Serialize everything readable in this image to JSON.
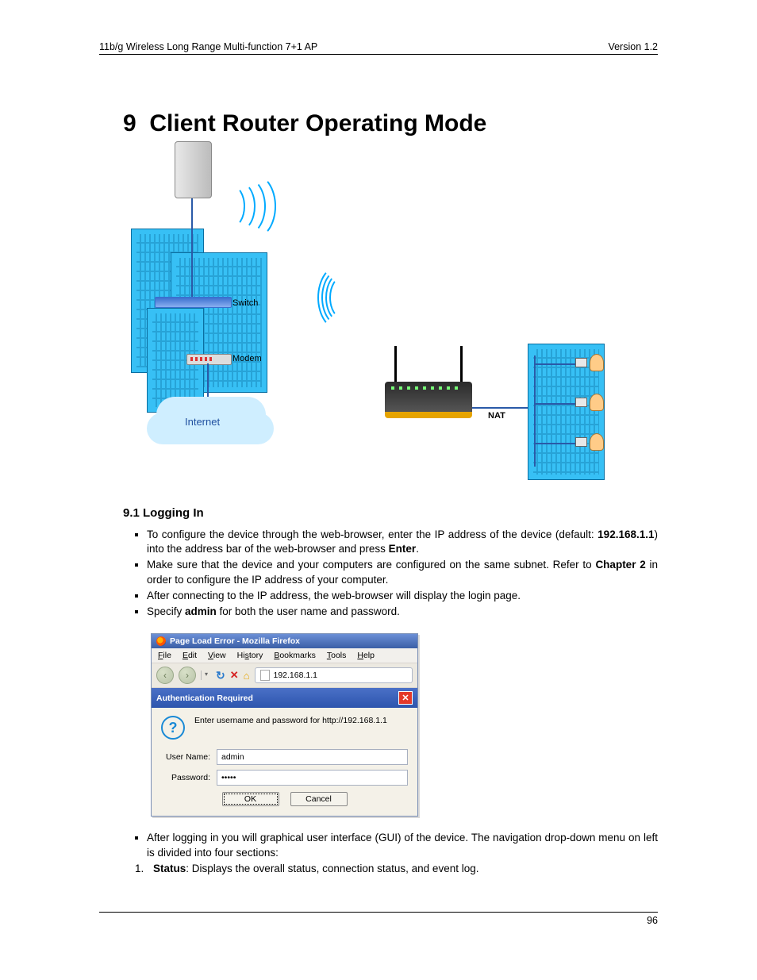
{
  "header": {
    "left": "11b/g Wireless Long Range Multi-function 7+1 AP",
    "right": "Version 1.2"
  },
  "chapter": {
    "number": "9",
    "title": "Client Router Operating Mode"
  },
  "diagram": {
    "switch": "Switch",
    "modem": "Modem",
    "internet": "Internet",
    "nat": "NAT"
  },
  "subheading": "9.1 Logging In",
  "bullets1": [
    {
      "pre": "To configure the device through the web-browser, enter the IP address of the device (default: ",
      "b1": "192.168.1.1",
      "mid": ") into the address bar of the web-browser and press ",
      "b2": "Enter",
      "post": "."
    },
    {
      "pre": "Make sure that the device and your computers are configured on the same subnet. Refer to ",
      "b1": "Chapter 2",
      "mid": " in order to configure the IP address of your computer.",
      "b2": "",
      "post": ""
    },
    {
      "pre": "After connecting to the IP address, the web-browser will display the login page.",
      "b1": "",
      "mid": "",
      "b2": "",
      "post": ""
    },
    {
      "pre": "Specify ",
      "b1": "admin",
      "mid": " for both the user name and password.",
      "b2": "",
      "post": ""
    }
  ],
  "firefox": {
    "title": "Page Load Error - Mozilla Firefox",
    "menu": [
      "File",
      "Edit",
      "View",
      "History",
      "Bookmarks",
      "Tools",
      "Help"
    ],
    "address": "192.168.1.1",
    "auth_title": "Authentication Required",
    "auth_msg": "Enter username and password for http://192.168.1.1",
    "username_label": "User Name:",
    "username_value": "admin",
    "password_label": "Password:",
    "password_value": "•••••",
    "ok": "OK",
    "cancel": "Cancel"
  },
  "bullets2": [
    {
      "text": "After logging in you will graphical user interface (GUI) of the device. The navigation drop-down menu on left is divided into four sections:"
    }
  ],
  "numbered": [
    {
      "b": "Status",
      "rest": ": Displays the overall status, connection status, and event log."
    }
  ],
  "pagenum": "96"
}
